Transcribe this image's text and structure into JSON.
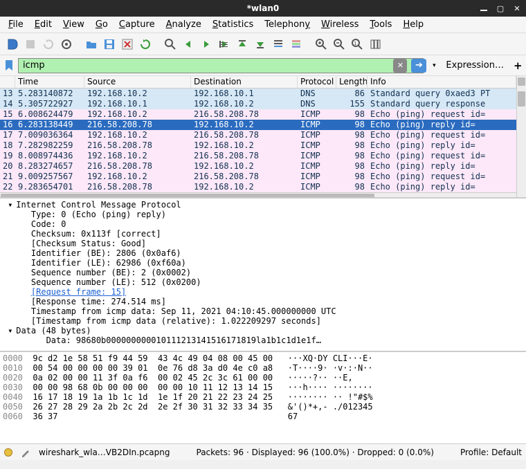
{
  "titlebar": {
    "title": "*wlan0"
  },
  "menubar": {
    "items": [
      {
        "label": "File",
        "key": "F"
      },
      {
        "label": "Edit",
        "key": "E"
      },
      {
        "label": "View",
        "key": "V"
      },
      {
        "label": "Go",
        "key": "G"
      },
      {
        "label": "Capture",
        "key": "C"
      },
      {
        "label": "Analyze",
        "key": "A"
      },
      {
        "label": "Statistics",
        "key": "S"
      },
      {
        "label": "Telephony",
        "key": "T"
      },
      {
        "label": "Wireless",
        "key": "W"
      },
      {
        "label": "Tools",
        "key": "T"
      },
      {
        "label": "Help",
        "key": "H"
      }
    ]
  },
  "filter": {
    "value": "icmp",
    "expression_label": "Expression…",
    "plus": "+"
  },
  "packets": {
    "headers": {
      "no": "",
      "time": "Time",
      "src": "Source",
      "dst": "Destination",
      "proto": "Protocol",
      "len": "Length",
      "info": "Info"
    },
    "rows": [
      {
        "no": "13",
        "time": "5.283140872",
        "src": "192.168.10.2",
        "dst": "192.168.10.1",
        "proto": "DNS",
        "len": "86",
        "info": "Standard query 0xaed3 PT",
        "cls": "row-blue"
      },
      {
        "no": "14",
        "time": "5.305722927",
        "src": "192.168.10.1",
        "dst": "192.168.10.2",
        "proto": "DNS",
        "len": "155",
        "info": "Standard query response",
        "cls": "row-blue"
      },
      {
        "no": "15",
        "time": "6.008624479",
        "src": "192.168.10.2",
        "dst": "216.58.208.78",
        "proto": "ICMP",
        "len": "98",
        "info": "Echo (ping) request  id=",
        "cls": "row-pink"
      },
      {
        "no": "16",
        "time": "6.283138449",
        "src": "216.58.208.78",
        "dst": "192.168.10.2",
        "proto": "ICMP",
        "len": "98",
        "info": "Echo (ping) reply    id=",
        "cls": "row-selected"
      },
      {
        "no": "17",
        "time": "7.009036364",
        "src": "192.168.10.2",
        "dst": "216.58.208.78",
        "proto": "ICMP",
        "len": "98",
        "info": "Echo (ping) request  id=",
        "cls": "row-pink"
      },
      {
        "no": "18",
        "time": "7.282982259",
        "src": "216.58.208.78",
        "dst": "192.168.10.2",
        "proto": "ICMP",
        "len": "98",
        "info": "Echo (ping) reply    id=",
        "cls": "row-pink"
      },
      {
        "no": "19",
        "time": "8.008974436",
        "src": "192.168.10.2",
        "dst": "216.58.208.78",
        "proto": "ICMP",
        "len": "98",
        "info": "Echo (ping) request  id=",
        "cls": "row-pink"
      },
      {
        "no": "20",
        "time": "8.283274657",
        "src": "216.58.208.78",
        "dst": "192.168.10.2",
        "proto": "ICMP",
        "len": "98",
        "info": "Echo (ping) reply    id=",
        "cls": "row-pink"
      },
      {
        "no": "21",
        "time": "9.009257567",
        "src": "192.168.10.2",
        "dst": "216.58.208.78",
        "proto": "ICMP",
        "len": "98",
        "info": "Echo (ping) request  id=",
        "cls": "row-pink"
      },
      {
        "no": "22",
        "time": "9.283654701",
        "src": "216.58.208.78",
        "dst": "192.168.10.2",
        "proto": "ICMP",
        "len": "98",
        "info": "Echo (ping) reply    id=",
        "cls": "row-pink"
      }
    ]
  },
  "details": {
    "lines": [
      {
        "indent": 0,
        "arrow": "▾",
        "text": "Internet Control Message Protocol"
      },
      {
        "indent": 1,
        "arrow": "",
        "text": "Type: 0 (Echo (ping) reply)"
      },
      {
        "indent": 1,
        "arrow": "",
        "text": "Code: 0"
      },
      {
        "indent": 1,
        "arrow": "",
        "text": "Checksum: 0x113f [correct]"
      },
      {
        "indent": 1,
        "arrow": "",
        "text": "[Checksum Status: Good]"
      },
      {
        "indent": 1,
        "arrow": "",
        "text": "Identifier (BE): 2806 (0x0af6)"
      },
      {
        "indent": 1,
        "arrow": "",
        "text": "Identifier (LE): 62986 (0xf60a)"
      },
      {
        "indent": 1,
        "arrow": "",
        "text": "Sequence number (BE): 2 (0x0002)"
      },
      {
        "indent": 1,
        "arrow": "",
        "text": "Sequence number (LE): 512 (0x0200)"
      },
      {
        "indent": 1,
        "arrow": "",
        "text": "[Request frame: 15]",
        "link": true
      },
      {
        "indent": 1,
        "arrow": "",
        "text": "[Response time: 274.514 ms]"
      },
      {
        "indent": 1,
        "arrow": "",
        "text": "Timestamp from icmp data: Sep 11, 2021 04:10:45.000000000 UTC"
      },
      {
        "indent": 1,
        "arrow": "",
        "text": "[Timestamp from icmp data (relative): 1.022209297 seconds]"
      },
      {
        "indent": 0,
        "arrow": "▾",
        "text": "Data (48 bytes)"
      },
      {
        "indent": 2,
        "arrow": "",
        "text": "Data: 98680b000000000010111213141516171819la1b1c1d1e1f…"
      }
    ]
  },
  "hex": {
    "rows": [
      {
        "off": "0000",
        "hex": "9c d2 1e 58 51 f9 44 59  43 4c 49 04 08 00 45 00",
        "asc": "···XQ·DY CLI···E·"
      },
      {
        "off": "0010",
        "hex": "00 54 00 00 00 00 39 01  0e 76 d8 3a d0 4e c0 a8",
        "asc": "·T····9· ·v·:·N··"
      },
      {
        "off": "0020",
        "hex": "0a 02 00 00 11 3f 0a f6  00 02 45 2c 3c 61 00 00",
        "asc": "·····?·· ··E,<a··"
      },
      {
        "off": "0030",
        "hex": "00 00 98 68 0b 00 00 00  00 00 10 11 12 13 14 15",
        "asc": "···h···· ········"
      },
      {
        "off": "0040",
        "hex": "16 17 18 19 1a 1b 1c 1d  1e 1f 20 21 22 23 24 25",
        "asc": "········ ·· !\"#$%"
      },
      {
        "off": "0050",
        "hex": "26 27 28 29 2a 2b 2c 2d  2e 2f 30 31 32 33 34 35",
        "asc": "&'()*+,- ./012345"
      },
      {
        "off": "0060",
        "hex": "36 37                                           ",
        "asc": "67"
      }
    ]
  },
  "statusbar": {
    "file": "wireshark_wla…VB2DIn.pcapng",
    "packets": "Packets: 96 · Displayed: 96 (100.0%) · Dropped: 0 (0.0%)",
    "profile": "Profile: Default"
  }
}
